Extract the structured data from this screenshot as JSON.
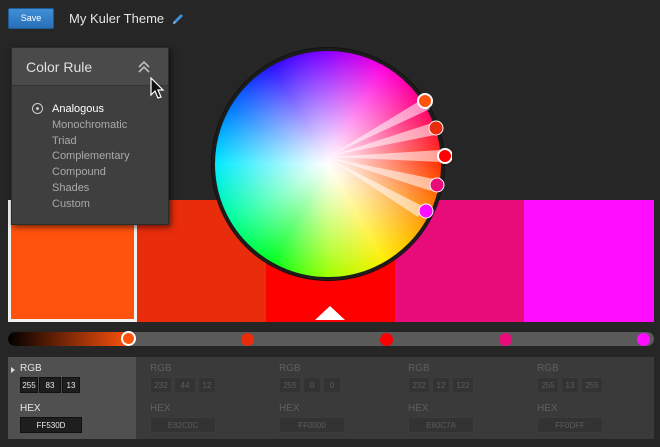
{
  "toolbar": {
    "save_label": "Save",
    "theme_title": "My Kuler Theme"
  },
  "color_rule": {
    "title": "Color Rule",
    "options": [
      "Analogous",
      "Monochromatic",
      "Triad",
      "Complementary",
      "Compound",
      "Shades",
      "Custom"
    ],
    "selected": "Analogous"
  },
  "swatches": [
    {
      "hex": "FF530D",
      "rgb": [
        "255",
        "83",
        "13"
      ],
      "color": "#ff530d",
      "selected": true
    },
    {
      "hex": "E82C0C",
      "rgb": [
        "232",
        "44",
        "12"
      ],
      "color": "#e82c0c",
      "selected": false
    },
    {
      "hex": "FF0000",
      "rgb": [
        "255",
        "0",
        "0"
      ],
      "color": "#ff0000",
      "selected": false
    },
    {
      "hex": "E80C7A",
      "rgb": [
        "232",
        "12",
        "122"
      ],
      "color": "#e80c7a",
      "selected": false
    },
    {
      "hex": "FF0DFF",
      "rgb": [
        "255",
        "13",
        "255"
      ],
      "color": "#ff0dff",
      "selected": false
    }
  ],
  "labels": {
    "rgb": "RGB",
    "hex": "HEX"
  },
  "icons": [
    "pencil-icon",
    "collapse-icon",
    "cursor-icon",
    "radio-icon",
    "caret-icon"
  ],
  "colors": {
    "accent": "#2a6fb8",
    "panel": "#3f3f3f",
    "background": "#262626"
  }
}
